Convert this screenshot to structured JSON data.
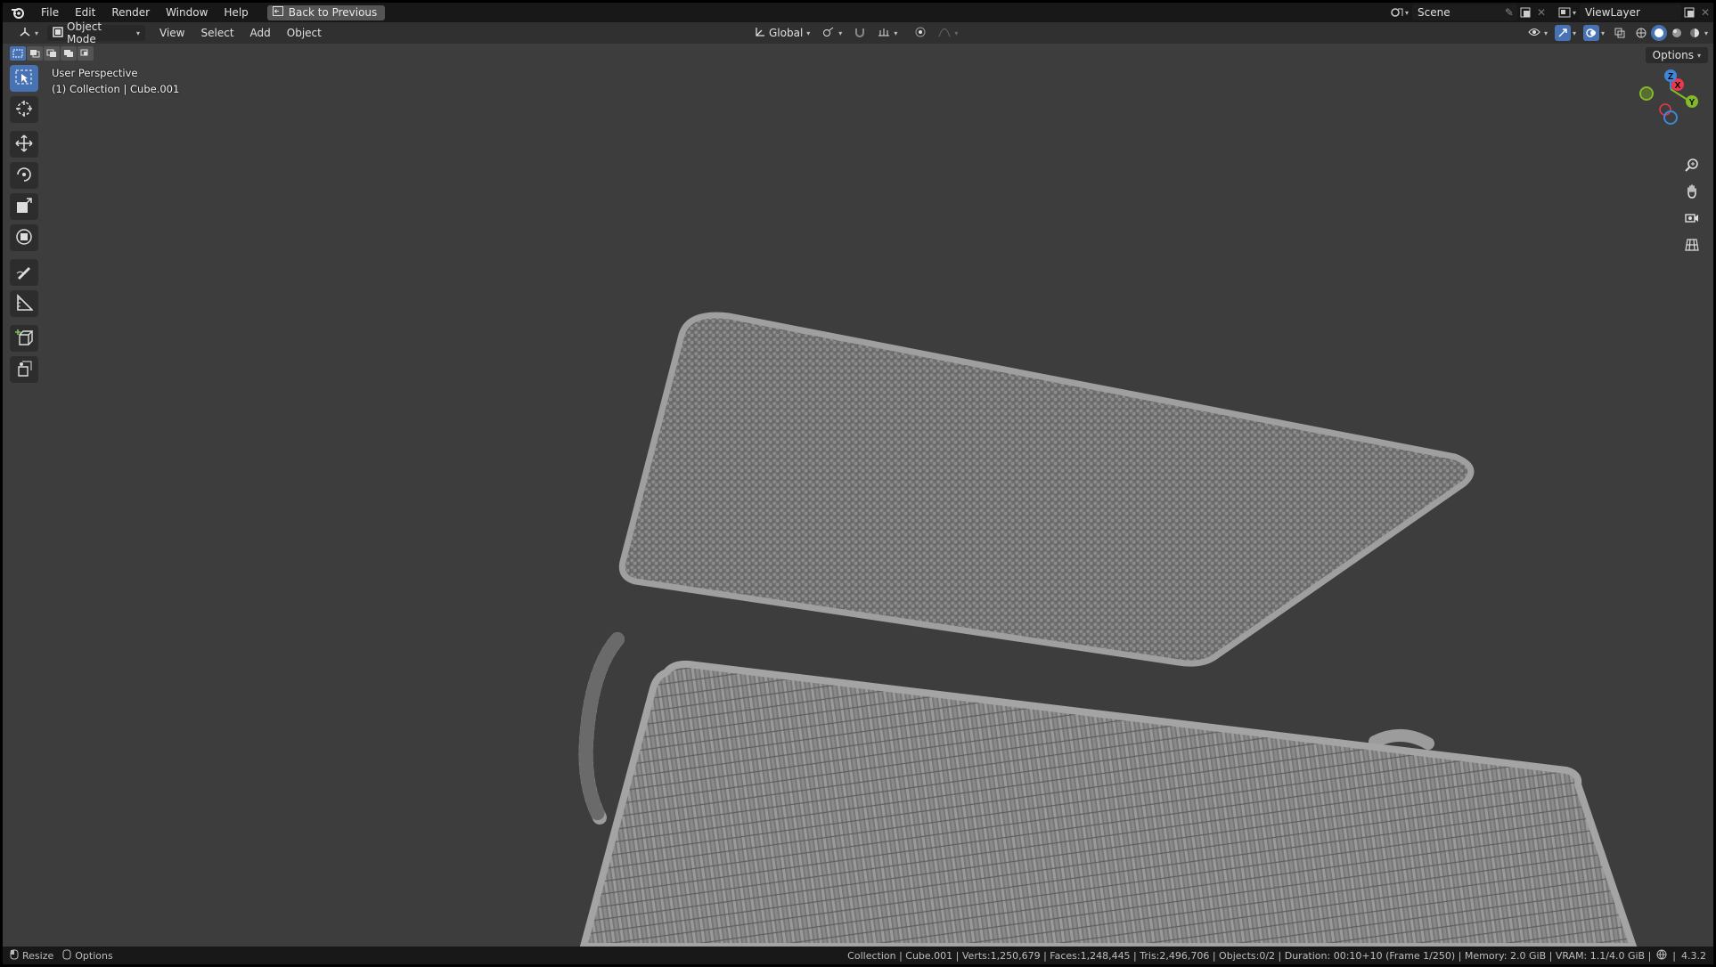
{
  "topbar": {
    "menus": [
      "File",
      "Edit",
      "Render",
      "Window",
      "Help"
    ],
    "back_button": "Back to Previous",
    "scene": "Scene",
    "view_layer": "ViewLayer"
  },
  "header": {
    "mode": "Object Mode",
    "menus": [
      "View",
      "Select",
      "Add",
      "Object"
    ],
    "orientation": "Global",
    "options": "Options"
  },
  "viewport": {
    "perspective": "User Perspective",
    "collection_info": "(1) Collection | Cube.001"
  },
  "gizmo": {
    "axes": [
      "X",
      "Y",
      "Z"
    ],
    "colors": {
      "x": "#e8394e",
      "y": "#83b92a",
      "z": "#3f86d8"
    }
  },
  "statusbar": {
    "left_actions": [
      "Resize",
      "Options"
    ],
    "stats": "Collection | Cube.001 | Verts:1,250,679 | Faces:1,248,445 | Tris:2,496,706 | Objects:0/2 | Duration: 00:10+10 (Frame 1/250) | Memory: 2.0 GiB | VRAM: 1.1/4.0 GiB |",
    "version": "4.3.2"
  },
  "icons": {
    "tools": [
      "select-box-icon",
      "cursor-icon",
      "move-icon",
      "rotate-icon",
      "scale-icon",
      "transform-icon",
      "annotate-icon",
      "measure-icon",
      "add-cube-icon",
      "extrude-icon"
    ],
    "nav": [
      "zoom-icon",
      "pan-hand-icon",
      "camera-icon",
      "grid-view-icon"
    ]
  }
}
